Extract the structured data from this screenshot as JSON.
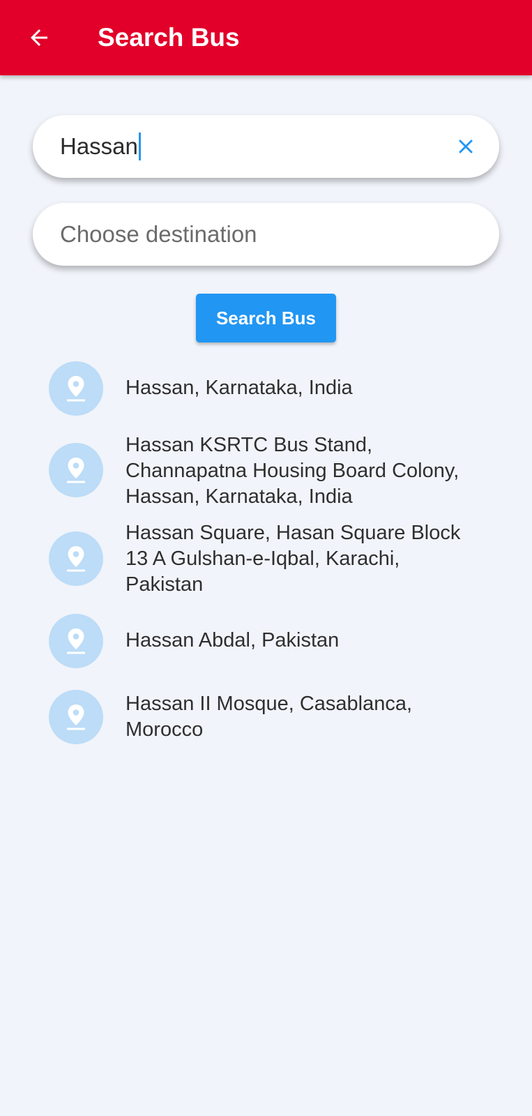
{
  "app_bar": {
    "title": "Search Bus",
    "back_icon": "arrow-left-icon",
    "background": "#e2002a"
  },
  "origin_field": {
    "value": "Hassan",
    "clear_icon": "close-icon"
  },
  "destination_field": {
    "placeholder": "Choose destination",
    "value": ""
  },
  "search_button": {
    "label": "Search Bus",
    "color": "#2196f3"
  },
  "suggestions": [
    {
      "line1": "Hassan, Karnataka, India",
      "icon": "location-pin-icon"
    },
    {
      "line1": "Hassan KSRTC Bus Stand,",
      "line2": "Channapatna Housing Board Colony,",
      "line3": "Hassan, Karnataka, India",
      "icon": "location-pin-icon"
    },
    {
      "line1": "Hassan Square, Hasan Square Block",
      "line2": "13 A Gulshan-e-Iqbal, Karachi,",
      "line3": "Pakistan",
      "icon": "location-pin-icon"
    },
    {
      "line1": "Hassan Abdal, Pakistan",
      "icon": "location-pin-icon"
    },
    {
      "line1": "Hassan II Mosque, Casablanca,",
      "line2": "Morocco",
      "icon": "location-pin-icon"
    }
  ]
}
